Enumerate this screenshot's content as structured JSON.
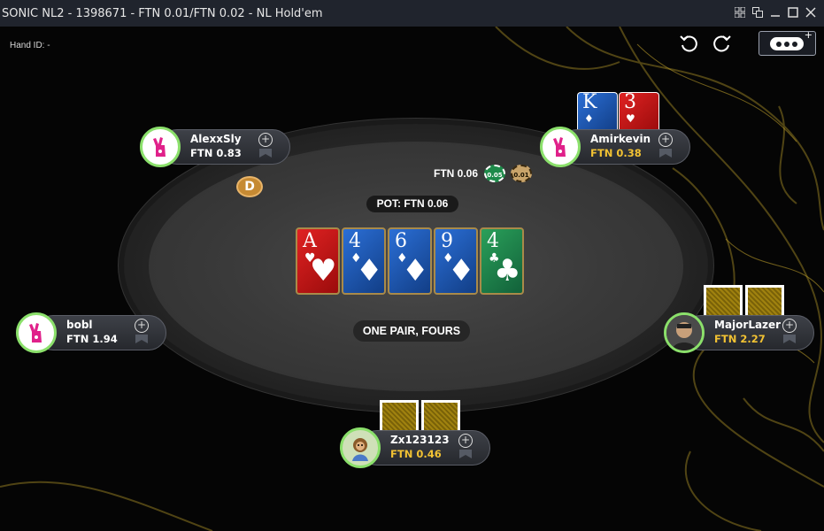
{
  "window": {
    "title": "SONIC NL2 - 1398671 - FTN 0.01/FTN 0.02 - NL Hold'em"
  },
  "hand_id": "Hand ID: -",
  "pot": "POT: FTN 0.06",
  "hand_description": "ONE PAIR, FOURS",
  "bet": {
    "amount": "FTN 0.06",
    "chips": [
      "0.05",
      "0.01"
    ]
  },
  "dealer_button": "D",
  "board": [
    {
      "rank": "A",
      "suit": "♥",
      "color": "red"
    },
    {
      "rank": "4",
      "suit": "♦",
      "color": "blue"
    },
    {
      "rank": "6",
      "suit": "♦",
      "color": "blue"
    },
    {
      "rank": "9",
      "suit": "♦",
      "color": "blue"
    },
    {
      "rank": "4",
      "suit": "♣",
      "color": "green"
    }
  ],
  "players": {
    "alexxsly": {
      "name": "AlexxSly",
      "stack": "FTN 0.83"
    },
    "amirkevin": {
      "name": "Amirkevin",
      "stack": "FTN 0.38",
      "cards": [
        {
          "rank": "K",
          "suit": "♦"
        },
        {
          "rank": "3",
          "suit": "♥"
        }
      ]
    },
    "bobl": {
      "name": "bobl",
      "stack": "FTN 1.94"
    },
    "majorlazer": {
      "name": "MajorLazer",
      "stack": "FTN 2.27"
    },
    "zx123123": {
      "name": "Zx123123",
      "stack": "FTN 0.46"
    }
  },
  "colors": {
    "seat_ring": "#8be06b",
    "stack_gold": "#f2c233"
  }
}
